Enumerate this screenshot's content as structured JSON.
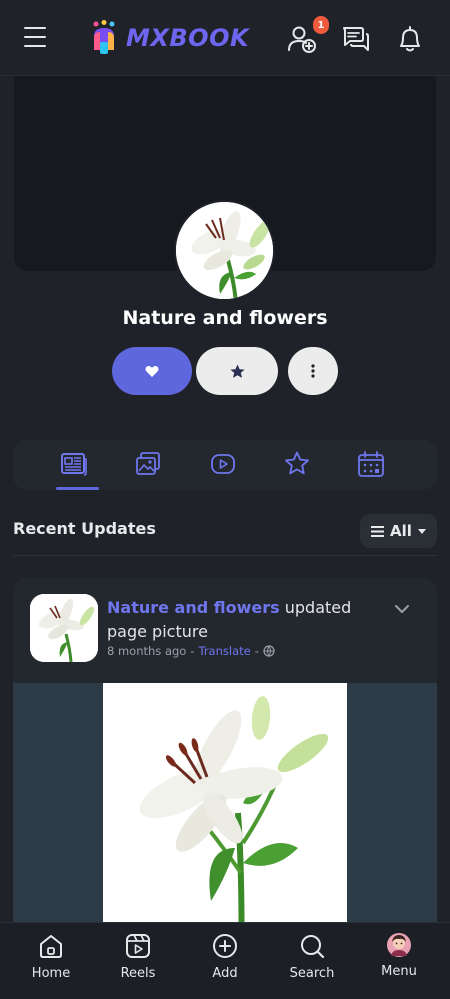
{
  "header": {
    "logo_text": "MXBOOK",
    "friend_requests_badge": "1",
    "icons": [
      "menu-icon",
      "add-friend-icon",
      "messages-icon",
      "bell-icon"
    ]
  },
  "page": {
    "title": "Nature and flowers"
  },
  "tabs": [
    "posts-icon",
    "photos-icon",
    "videos-icon",
    "reviews-icon",
    "events-icon"
  ],
  "recent_updates": {
    "title": "Recent Updates",
    "filter_label": "All"
  },
  "post": {
    "author": "Nature and flowers",
    "action_text": " updated page picture",
    "time": "8 months ago",
    "separator_1": "-",
    "translate_label": "Translate",
    "separator_2": "-"
  },
  "bottom_nav": {
    "home": "Home",
    "reels": "Reels",
    "add": "Add",
    "search": "Search",
    "menu": "Menu"
  },
  "colors": {
    "accent": "#5f67dd",
    "background": "#1f2329",
    "badge": "#ef5a3c"
  }
}
